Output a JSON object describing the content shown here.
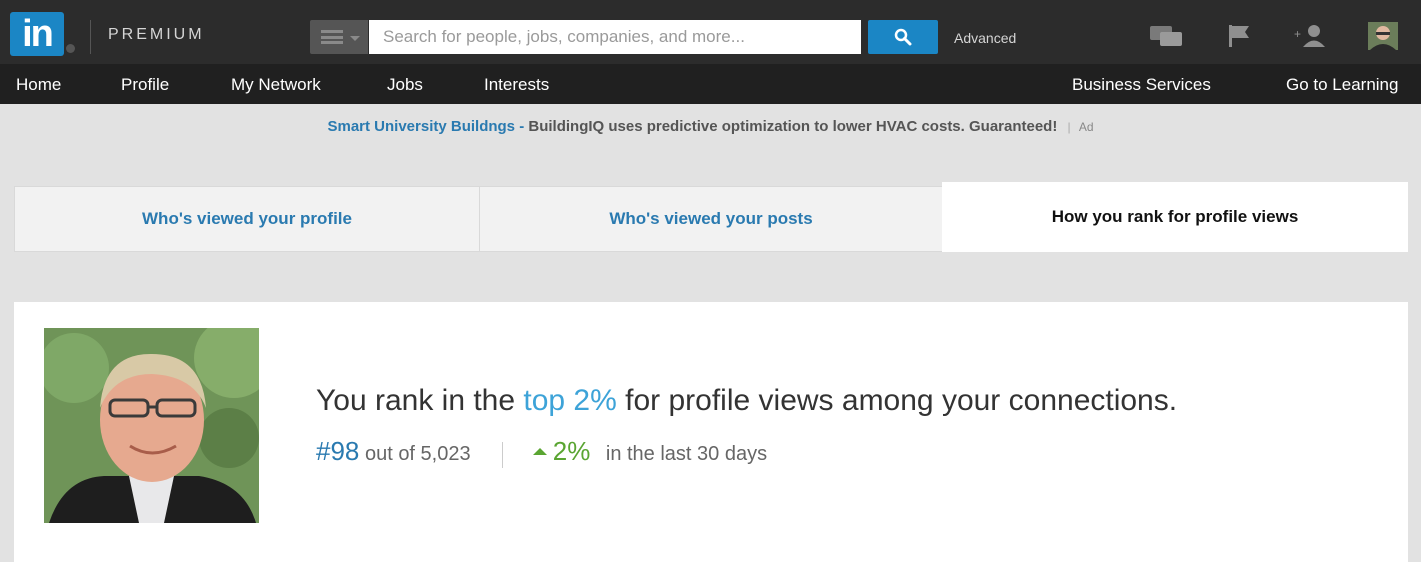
{
  "topbar": {
    "logo_text": "in",
    "brand_label": "PREMIUM",
    "search_placeholder": "Search for people, jobs, companies, and more...",
    "advanced_label": "Advanced",
    "icons": [
      "menu-icon",
      "search-icon",
      "messages-icon",
      "flag-icon",
      "add-connection-icon",
      "profile-avatar"
    ]
  },
  "nav": {
    "items": [
      "Home",
      "Profile",
      "My Network",
      "Jobs",
      "Interests"
    ],
    "right_items": [
      "Business Services",
      "Go to Learning"
    ]
  },
  "ad": {
    "link_text": "Smart University Buildngs -",
    "body_text": "BuildingIQ uses predictive optimization to lower HVAC costs. Guaranteed!",
    "separator": "|",
    "label": "Ad"
  },
  "tabs": [
    {
      "label": "Who's viewed your profile",
      "active": false
    },
    {
      "label": "Who's viewed your posts",
      "active": false
    },
    {
      "label": "How you rank for profile views",
      "active": true
    }
  ],
  "rank": {
    "headline_prefix": "You rank in the",
    "headline_highlight": "top 2%",
    "headline_suffix": "for profile views among your connections.",
    "rank_number": "#98",
    "rank_total": "out of 5,023",
    "change_pct": "2%",
    "change_period": "in the last 30 days"
  },
  "colors": {
    "brand_blue": "#1b86c5",
    "highlight_blue": "#3da3d8",
    "positive_green": "#5aa532",
    "topbar_bg": "#2c2c2c",
    "navbar_bg": "#202020"
  }
}
